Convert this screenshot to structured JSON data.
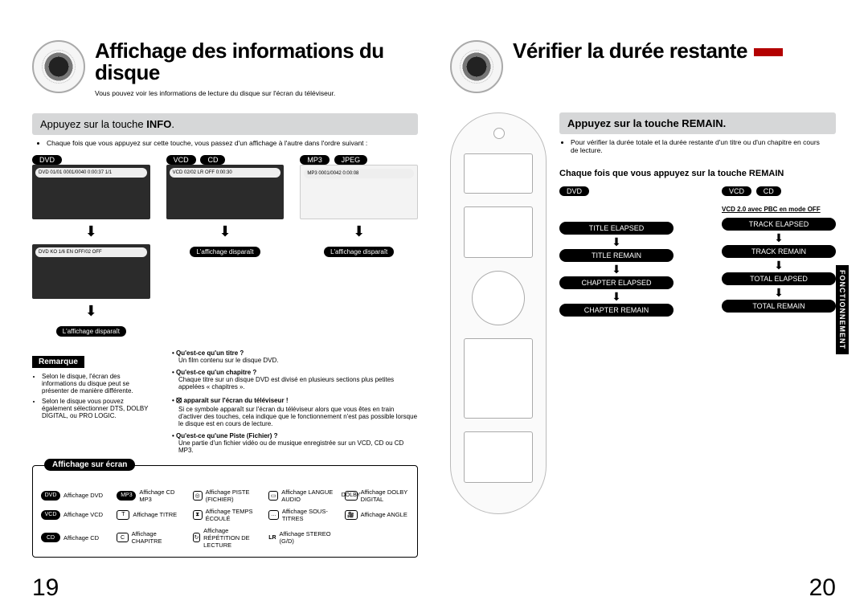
{
  "left": {
    "title": "Affichage des informations du disque",
    "intro": "Vous pouvez voir les informations de lecture du disque sur l'écran du téléviseur.",
    "bar": {
      "plain": "Appuyez sur la touche ",
      "bold": "INFO"
    },
    "barsub": "Chaque fois que vous appuyez sur cette touche, vous passez d'un affichage à l'autre dans l'ordre suivant :",
    "pills": {
      "dvd": "DVD",
      "vcd": "VCD",
      "cd": "CD",
      "mp3": "MP3",
      "jpeg": "JPEG"
    },
    "osd1": "DVD   01/01   0001/0040   0:00:37   1/1",
    "osd2": "VCD   02/02   LR   OFF   0:00:30",
    "osd3": "MP3   0001/0042   0:00:08",
    "osd4": "DVD   KO 1/6   EN   OFF/02   OFF",
    "caption": "L'affichage disparaît",
    "remarqueLabel": "Remarque",
    "remarques": [
      "Selon le disque, l'écran des informations du disque peut se présenter de manière différente.",
      "Selon le disque vous pouvez également sélectionner DTS, DOLBY DIGITAL, ou PRO LOGIC."
    ],
    "qa": {
      "q1": "Qu'est-ce qu'un titre ?",
      "a1": "Un film contenu sur le disque DVD.",
      "q2": "Qu'est-ce qu'un chapitre ?",
      "a2": "Chaque titre sur un disque DVD est divisé en plusieurs sections plus petites appelées «  chapitres  ».",
      "q3": "apparaît sur l'écran du téléviseur !",
      "a3": "Si ce symbole apparaît sur l'écran du téléviseur alors que vous êtes en train d'activer des touches, cela indique que le fonctionnement n'est pas possible lorsque le disque est en cours de lecture.",
      "q4": "Qu'est-ce qu'une Piste (Fichier) ?",
      "a4": "Une partie d'un fichier vidéo ou de musique enregistrée sur un VCD, CD ou CD MP3."
    },
    "legendTitle": "Affichage sur écran",
    "legend": {
      "l1": {
        "ic": "DVD",
        "t": "Affichage DVD"
      },
      "l2": {
        "ic": "MP3",
        "t": "Affichage CD MP3"
      },
      "l3": {
        "ic": "◎",
        "t": "Affichage PISTE (FICHIER)"
      },
      "l4": {
        "ic": "▭",
        "t": "Affichage LANGUE AUDIO"
      },
      "l5": {
        "ic": "DOLBY",
        "t": "Affichage DOLBY DIGITAL"
      },
      "l6": {
        "ic": "VCD",
        "t": "Affichage VCD"
      },
      "l7": {
        "ic": "T",
        "t": "Affichage TITRE"
      },
      "l8": {
        "ic": "⧗",
        "t": "Affichage TEMPS ÉCOULÉ"
      },
      "l9": {
        "ic": "…",
        "t": "Affichage SOUS-TITRES"
      },
      "l10": {
        "ic": "🎥",
        "t": "Affichage ANGLE"
      },
      "l11": {
        "ic": "CD",
        "t": "Affichage CD"
      },
      "l12": {
        "ic": "C",
        "t": "Affichage CHAPITRE"
      },
      "l13": {
        "ic": "↻",
        "t": "Affichage RÉPÉTITION DE LECTURE"
      },
      "l14": {
        "ic": "LR",
        "t": "Affichage STEREO (G/D)"
      }
    },
    "pageNum": "19"
  },
  "right": {
    "title": "Vérifier la durée restante",
    "bar": "Appuyez sur la touche REMAIN.",
    "barsub": "Pour vérifier la durée totale et la durée restante d'un titre ou d'un chapitre en cours de lecture.",
    "seqHead": "Chaque fois que vous appuyez sur la touche REMAIN",
    "dvd": {
      "label": "DVD",
      "steps": [
        "TITLE ELAPSED",
        "TITLE REMAIN",
        "CHAPTER ELAPSED",
        "CHAPTER REMAIN"
      ]
    },
    "vcd": {
      "label1": "VCD",
      "label2": "CD",
      "note": "VCD 2.0 avec PBC en mode OFF",
      "steps": [
        "TRACK ELAPSED",
        "TRACK REMAIN",
        "TOTAL ELAPSED",
        "TOTAL REMAIN"
      ]
    },
    "sideTab": "FONCTIONNEMENT",
    "pageNum": "20"
  }
}
